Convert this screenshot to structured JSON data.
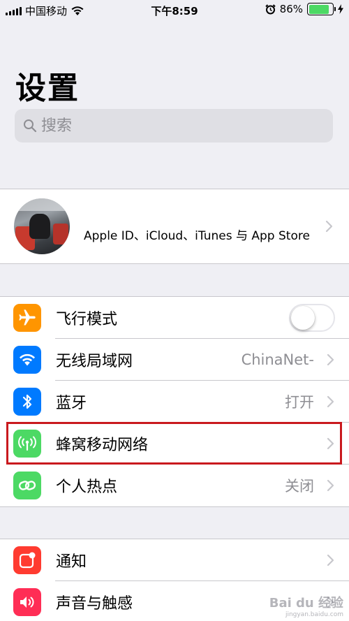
{
  "status_bar": {
    "carrier": "中国移动",
    "time": "下午8:59",
    "battery_percent": "86%",
    "battery_level": 0.86,
    "icons": [
      "signal-icon",
      "wifi-icon",
      "alarm-icon",
      "battery-icon",
      "charging-icon"
    ]
  },
  "page": {
    "title": "设置"
  },
  "search": {
    "placeholder": "搜索"
  },
  "profile": {
    "label": "Apple ID、iCloud、iTunes 与 App Store"
  },
  "group1": [
    {
      "label": "飞行模式",
      "icon": "airplane-icon",
      "color": "#ff9500",
      "toggle": false
    },
    {
      "label": "无线局域网",
      "icon": "wifi-icon",
      "color": "#007aff",
      "value": "ChinaNet-"
    },
    {
      "label": "蓝牙",
      "icon": "bluetooth-icon",
      "color": "#007aff",
      "value": "打开"
    },
    {
      "label": "蜂窝移动网络",
      "icon": "cellular-icon",
      "color": "#4cd964",
      "value": ""
    },
    {
      "label": "个人热点",
      "icon": "hotspot-icon",
      "color": "#4cd964",
      "value": "关闭"
    }
  ],
  "group2": [
    {
      "label": "通知",
      "icon": "notifications-icon",
      "color": "#ff3b30"
    },
    {
      "label": "声音与触感",
      "icon": "sounds-icon",
      "color": "#ff2d55"
    }
  ],
  "watermark": {
    "text": "Bai du 经验",
    "sub": "jingyan.baidu.com"
  },
  "colors": {
    "highlight": "#c9191e",
    "toggle_off": "#e5e5ea",
    "chevron": "#c7c7cc",
    "battery_fill": "#4cd964"
  }
}
